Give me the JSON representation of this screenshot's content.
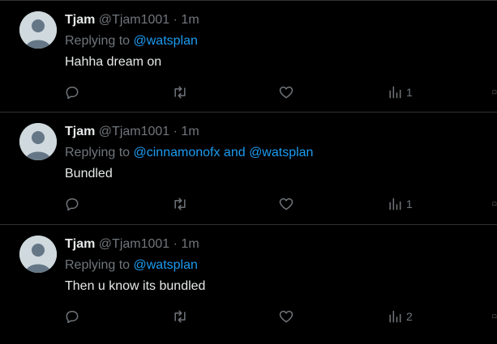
{
  "tweets": [
    {
      "name": "Tjam",
      "handle": "@Tjam1001",
      "separator": "·",
      "time": "1m",
      "replying_prefix": "Replying to ",
      "mentions": [
        "@watsplan"
      ],
      "joiner": "",
      "text": "Hahha dream on",
      "views": "1"
    },
    {
      "name": "Tjam",
      "handle": "@Tjam1001",
      "separator": "·",
      "time": "1m",
      "replying_prefix": "Replying to ",
      "mentions": [
        "@cinnamonofx",
        "@watsplan"
      ],
      "joiner": " and ",
      "text": "Bundled",
      "views": "1"
    },
    {
      "name": "Tjam",
      "handle": "@Tjam1001",
      "separator": "·",
      "time": "1m",
      "replying_prefix": "Replying to ",
      "mentions": [
        "@watsplan"
      ],
      "joiner": "",
      "text": "Then u know its bundled",
      "views": "2"
    }
  ],
  "icons": {
    "reply": "reply-icon",
    "retweet": "retweet-icon",
    "like": "heart-icon",
    "views": "views-icon",
    "bookmark": "bookmark-icon"
  },
  "colors": {
    "background": "#000000",
    "text": "#e7e9ea",
    "muted": "#71767b",
    "link": "#1d9bf0",
    "divider": "#2f3336"
  }
}
